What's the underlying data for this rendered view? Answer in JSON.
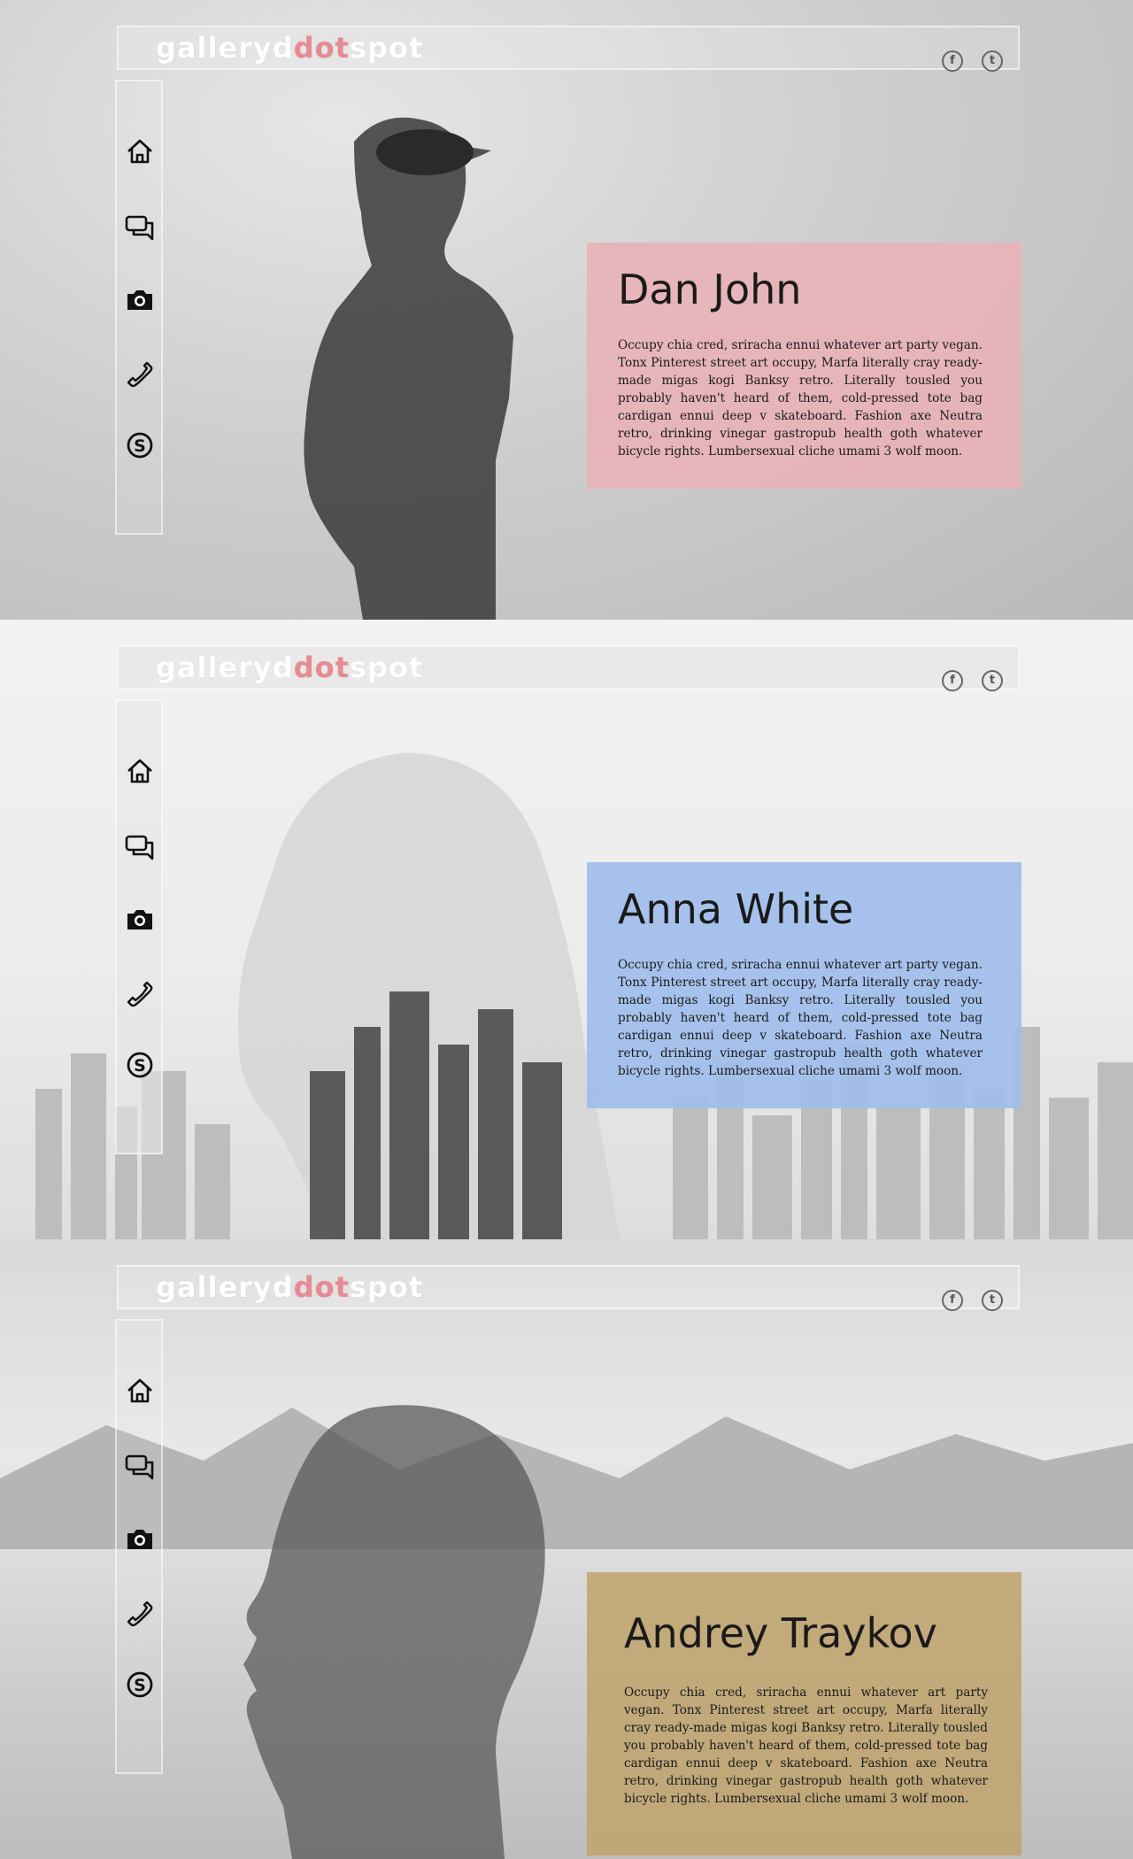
{
  "logo": {
    "left": "galleryd",
    "middle": "dot",
    "right": "spot"
  },
  "social": {
    "facebook_glyph": "f",
    "twitter_glyph": "t"
  },
  "nav_icons": [
    "home-icon",
    "chat-icon",
    "camera-icon",
    "phone-icon",
    "skype-icon"
  ],
  "colors": {
    "logo_accent": "#e88a91",
    "card_pink": "#e9b2b7",
    "card_blue": "#a0beec",
    "card_gold": "#bfa46e"
  },
  "sections": [
    {
      "name": "Dan John",
      "bio": "Occupy chia cred, sriracha ennui whatever art party vegan. Tonx Pinterest street art occupy, Marfa literally cray ready-made migas kogi Banksy retro. Literally tousled you probably haven't heard of them, cold-pressed tote bag cardigan ennui deep v skateboard. Fashion axe Neutra retro, drinking vinegar gastropub health goth whatever bicycle rights. Lumbersexual cliche umami 3 wolf moon."
    },
    {
      "name": "Anna White",
      "bio": "Occupy chia cred, sriracha ennui whatever art party vegan. Tonx Pinterest street art occupy, Marfa literally cray ready-made migas kogi Banksy retro. Literally tousled you probably haven't heard of them, cold-pressed tote bag cardigan ennui deep v skateboard. Fashion axe Neutra retro, drinking vinegar gastropub health goth whatever bicycle rights. Lumbersexual cliche umami 3 wolf moon."
    },
    {
      "name": "Andrey Traykov",
      "bio": "Occupy chia cred, sriracha ennui whatever art party vegan. Tonx Pinterest street art occupy, Marfa literally cray ready-made migas kogi Banksy retro. Literally tousled you probably haven't heard of them, cold-pressed tote bag cardigan ennui deep v skateboard. Fashion axe Neutra retro, drinking vinegar gastropub health goth whatever bicycle rights. Lumbersexual cliche umami 3 wolf moon."
    }
  ]
}
